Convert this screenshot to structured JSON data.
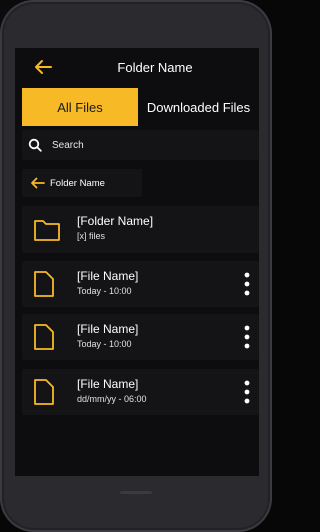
{
  "header": {
    "title": "Folder Name"
  },
  "tabs": [
    {
      "label": "All Files",
      "active": true
    },
    {
      "label": "Downloaded Files",
      "active": false
    }
  ],
  "search": {
    "placeholder": "Search"
  },
  "breadcrumb": {
    "label": "Folder Name"
  },
  "items": [
    {
      "type": "folder",
      "title": "[Folder Name]",
      "subtitle": "[x] files",
      "icon": "folder-icon"
    },
    {
      "type": "file",
      "title": "[File Name]",
      "subtitle": "Today - 10:00",
      "icon": "file-icon"
    },
    {
      "type": "file",
      "title": "[File Name]",
      "subtitle": "Today - 10:00",
      "icon": "file-icon"
    },
    {
      "type": "file",
      "title": "[File Name]",
      "subtitle": "dd/mm/yy - 06:00",
      "icon": "file-icon"
    }
  ],
  "colors": {
    "accent": "#f7b926",
    "screen_bg": "#0d0d0f",
    "row_bg": "#141417",
    "text": "#ffffff"
  }
}
